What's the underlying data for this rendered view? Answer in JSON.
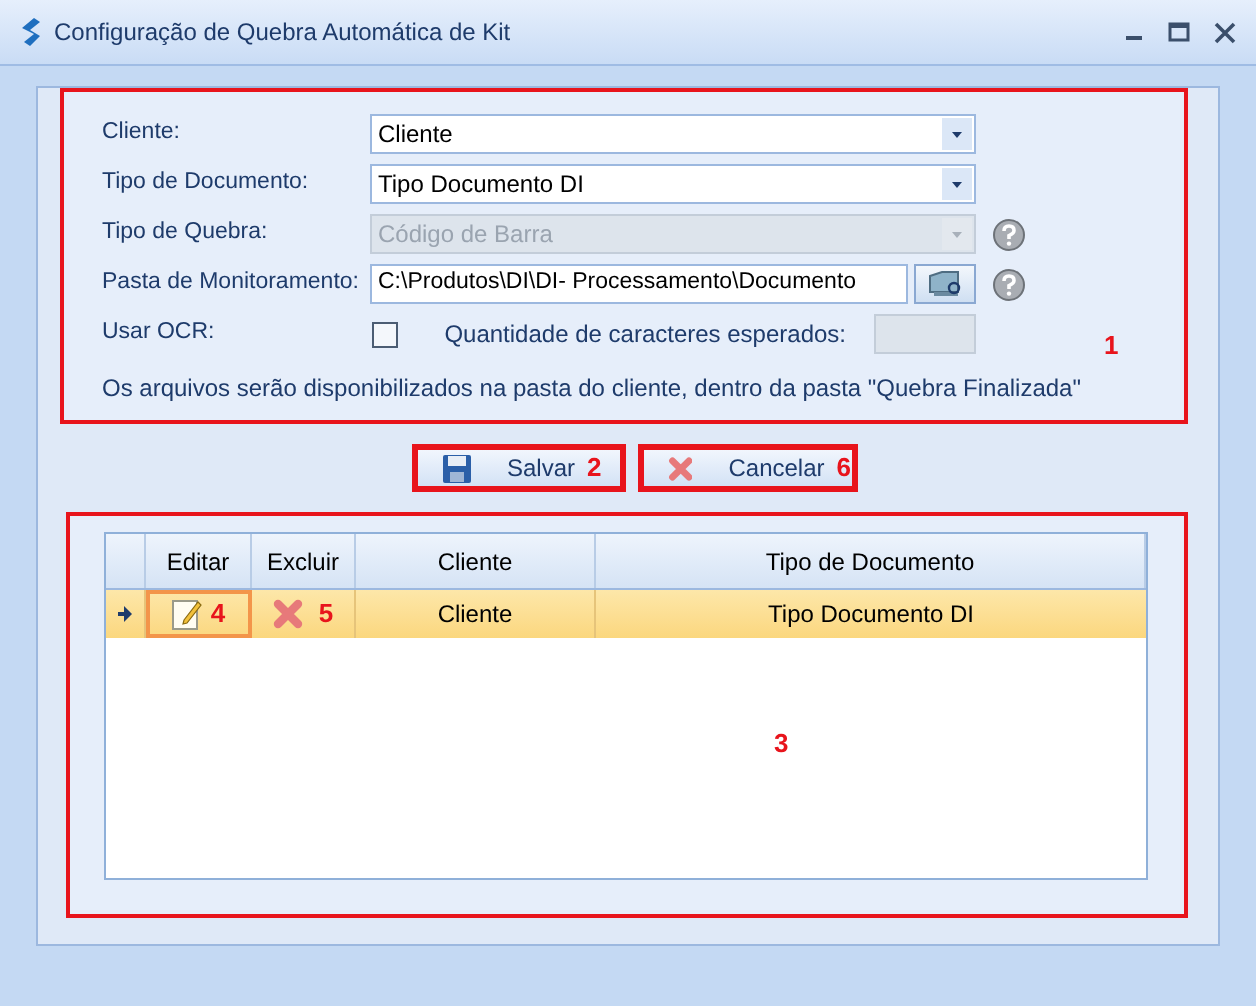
{
  "window": {
    "title": "Configuração de Quebra Automática de Kit"
  },
  "form": {
    "marker": "1",
    "fields": [
      {
        "kind": "combo",
        "label": "Cliente:",
        "value": "Cliente",
        "disabled": false,
        "help": false
      },
      {
        "kind": "combo",
        "label": "Tipo de Documento:",
        "value": "Tipo Documento DI",
        "disabled": false,
        "help": false
      },
      {
        "kind": "combo",
        "label": "Tipo de Quebra:",
        "value": "Código de Barra",
        "disabled": true,
        "help": true
      },
      {
        "kind": "path",
        "label": "Pasta de Monitoramento:",
        "value": "C:\\Produtos\\DI\\DI- Processamento\\Documento",
        "help": true
      },
      {
        "kind": "checkbox",
        "label": "Usar OCR:",
        "checked": false,
        "extra_label": "Quantidade de caracteres esperados:",
        "extra_disabled": true
      }
    ],
    "note": "Os arquivos serão disponibilizados na pasta do cliente, dentro da pasta \"Quebra Finalizada\""
  },
  "buttons": [
    {
      "kind": "save",
      "label": "Salvar",
      "marker": "2"
    },
    {
      "kind": "cancel",
      "label": "Cancelar",
      "marker": "6"
    }
  ],
  "grid": {
    "marker": "3",
    "columns": [
      "Editar",
      "Excluir",
      "Cliente",
      "Tipo de Documento"
    ],
    "rows": [
      {
        "selected": true,
        "edit_marker": "4",
        "delete_marker": "5",
        "cliente": "Cliente",
        "tipo": "Tipo Documento DI"
      }
    ]
  }
}
